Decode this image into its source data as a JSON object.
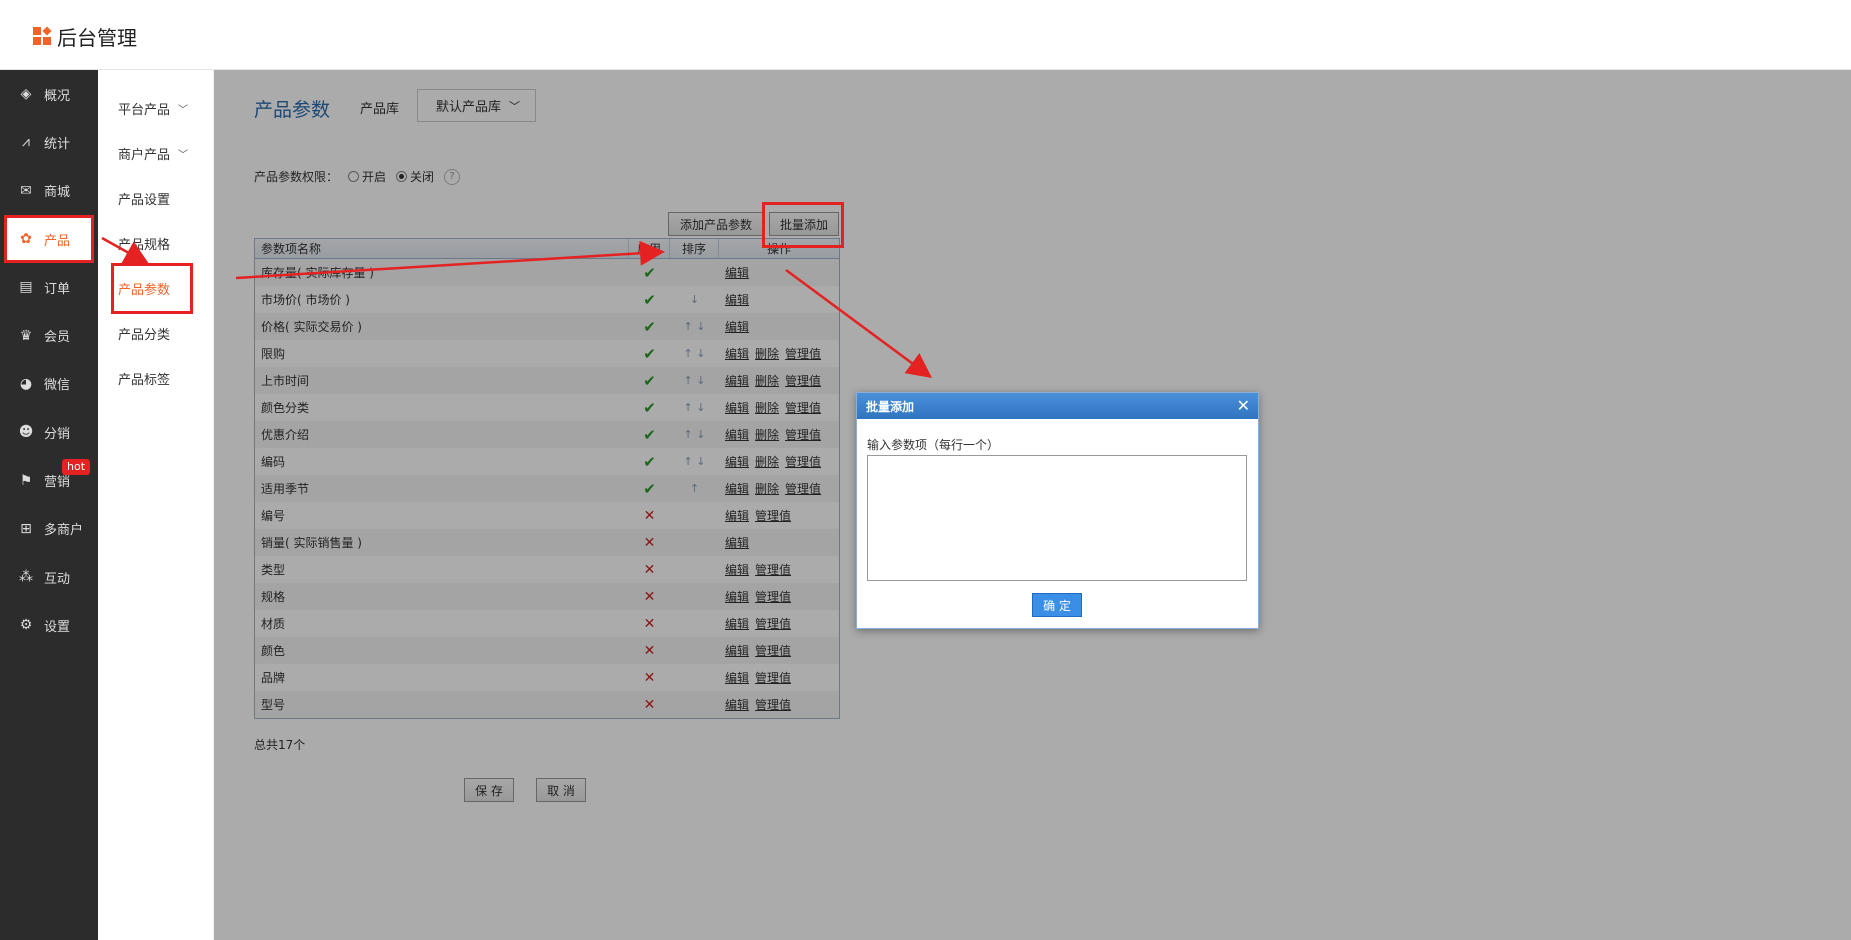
{
  "app": {
    "title": "后台管理"
  },
  "sidebar": {
    "items": [
      {
        "label": "概况",
        "icon": "layers-icon",
        "glyph": "◈"
      },
      {
        "label": "统计",
        "icon": "chart-icon",
        "glyph": "⩘"
      },
      {
        "label": "商城",
        "icon": "mail-icon",
        "glyph": "✉"
      },
      {
        "label": "产品",
        "icon": "grid-icon",
        "glyph": "✿"
      },
      {
        "label": "订单",
        "icon": "clipboard-icon",
        "glyph": "▤"
      },
      {
        "label": "会员",
        "icon": "crown-icon",
        "glyph": "♛"
      },
      {
        "label": "微信",
        "icon": "wechat-icon",
        "glyph": "◕"
      },
      {
        "label": "分销",
        "icon": "user-icon",
        "glyph": "☻"
      },
      {
        "label": "营销",
        "icon": "flag-icon",
        "glyph": "⚑",
        "badge": "hot"
      },
      {
        "label": "多商户",
        "icon": "store-icon",
        "glyph": "⊞"
      },
      {
        "label": "互动",
        "icon": "people-icon",
        "glyph": "⁂"
      },
      {
        "label": "设置",
        "icon": "gear-icon",
        "glyph": "⚙"
      }
    ]
  },
  "submenu": {
    "items": [
      {
        "label": "平台产品",
        "chevron": "﹀"
      },
      {
        "label": "商户产品",
        "chevron": "﹀"
      },
      {
        "label": "产品设置"
      },
      {
        "label": "产品规格"
      },
      {
        "label": "产品参数"
      },
      {
        "label": "产品分类"
      },
      {
        "label": "产品标签"
      }
    ]
  },
  "main": {
    "title": "产品参数",
    "library_label": "产品库",
    "library_value": "默认产品库",
    "library_chevron": "﹀",
    "perm_label": "产品参数权限：",
    "perm_on": "开启",
    "perm_off": "关闭",
    "help": "?",
    "add_button": "添加产品参数",
    "batch_button": "批量添加",
    "table": {
      "headers": {
        "name": "参数项名称",
        "use": "启用",
        "sort": "排序",
        "op": "操作"
      },
      "rows": [
        {
          "name": "库存量( 实际库存量 )",
          "enabled": "✔",
          "sort": "",
          "ops": [
            "编辑"
          ]
        },
        {
          "name": "市场价( 市场价 )",
          "enabled": "✔",
          "sort": "↓",
          "ops": [
            "编辑"
          ]
        },
        {
          "name": "价格( 实际交易价 )",
          "enabled": "✔",
          "sort": "↑ ↓",
          "ops": [
            "编辑"
          ]
        },
        {
          "name": "限购",
          "enabled": "✔",
          "sort": "↑ ↓",
          "ops": [
            "编辑",
            "删除",
            "管理值"
          ]
        },
        {
          "name": "上市时间",
          "enabled": "✔",
          "sort": "↑ ↓",
          "ops": [
            "编辑",
            "删除",
            "管理值"
          ]
        },
        {
          "name": "颜色分类",
          "enabled": "✔",
          "sort": "↑ ↓",
          "ops": [
            "编辑",
            "删除",
            "管理值"
          ]
        },
        {
          "name": "优惠介绍",
          "enabled": "✔",
          "sort": "↑ ↓",
          "ops": [
            "编辑",
            "删除",
            "管理值"
          ]
        },
        {
          "name": "编码",
          "enabled": "✔",
          "sort": "↑ ↓",
          "ops": [
            "编辑",
            "删除",
            "管理值"
          ]
        },
        {
          "name": "适用季节",
          "enabled": "✔",
          "sort": "↑",
          "ops": [
            "编辑",
            "删除",
            "管理值"
          ]
        },
        {
          "name": "编号",
          "enabled": "✕",
          "sort": "",
          "ops": [
            "编辑",
            "管理值"
          ]
        },
        {
          "name": "销量( 实际销售量 )",
          "enabled": "✕",
          "sort": "",
          "ops": [
            "编辑"
          ]
        },
        {
          "name": "类型",
          "enabled": "✕",
          "sort": "",
          "ops": [
            "编辑",
            "管理值"
          ]
        },
        {
          "name": "规格",
          "enabled": "✕",
          "sort": "",
          "ops": [
            "编辑",
            "管理值"
          ]
        },
        {
          "name": "材质",
          "enabled": "✕",
          "sort": "",
          "ops": [
            "编辑",
            "管理值"
          ]
        },
        {
          "name": "颜色",
          "enabled": "✕",
          "sort": "",
          "ops": [
            "编辑",
            "管理值"
          ]
        },
        {
          "name": "品牌",
          "enabled": "✕",
          "sort": "",
          "ops": [
            "编辑",
            "管理值"
          ]
        },
        {
          "name": "型号",
          "enabled": "✕",
          "sort": "",
          "ops": [
            "编辑",
            "管理值"
          ]
        }
      ]
    },
    "total": "总共17个",
    "save": "保 存",
    "cancel": "取 消"
  },
  "dialog": {
    "title": "批量添加",
    "close": "✕",
    "label": "输入参数项（每行一个）",
    "textarea_value": "",
    "ok": "确 定"
  },
  "colors": {
    "accent": "#f0642a",
    "sidebar": "#2c2c2c",
    "annotation": "#e52222",
    "dialog_header": "#3a80cc"
  }
}
